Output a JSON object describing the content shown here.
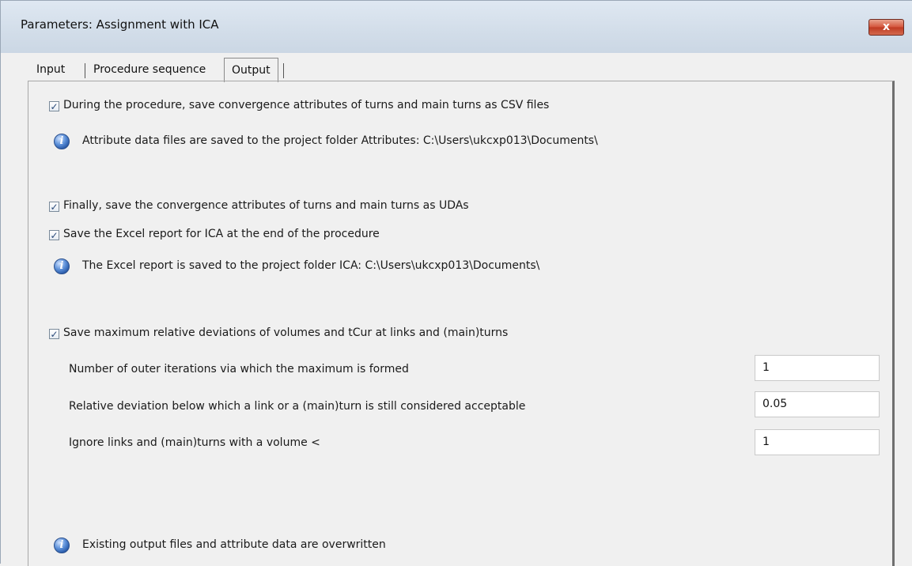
{
  "window": {
    "title": "Parameters: Assignment with ICA",
    "close_label": "x"
  },
  "tabs": [
    {
      "label": "Input",
      "active": false
    },
    {
      "label": "Procedure sequence",
      "active": false
    },
    {
      "label": "Output",
      "active": true
    }
  ],
  "output": {
    "save_csv": {
      "checked": true,
      "label": "During the procedure, save convergence attributes of turns and main turns as CSV files"
    },
    "csv_info": "Attribute data files are saved to the project folder Attributes: C:\\Users\\ukcxp013\\Documents\\",
    "save_udas": {
      "checked": true,
      "label": "Finally, save the convergence attributes of turns and main turns as UDAs"
    },
    "save_excel": {
      "checked": true,
      "label": "Save the Excel report for ICA at the end of the procedure"
    },
    "excel_info": "The Excel report is saved to the project folder ICA: C:\\Users\\ukcxp013\\Documents\\",
    "save_max_dev": {
      "checked": true,
      "label": "Save maximum relative deviations of volumes and tCur at links and (main)turns"
    },
    "outer_iterations": {
      "label": "Number of outer iterations via which the maximum is formed",
      "value": "1"
    },
    "relative_deviation": {
      "label": "Relative deviation below which a link or a (main)turn is still considered acceptable",
      "value": "0.05"
    },
    "ignore_volume": {
      "label": "Ignore links and (main)turns with a volume <",
      "value": "1"
    },
    "overwrite_info": "Existing output files and attribute data are overwritten"
  },
  "icons": {
    "checkbox_check": "✓",
    "info": "i"
  },
  "colors": {
    "titlebar": "#d2dde9",
    "close_button": "#c9472e",
    "background": "#f0f0f0",
    "info_icon": "#2f6ac0"
  }
}
